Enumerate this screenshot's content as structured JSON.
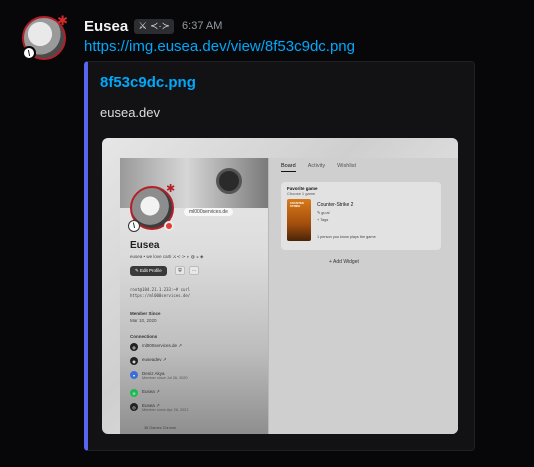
{
  "message": {
    "username": "Eusea",
    "role_badge": "⚔ ≺·≻",
    "timestamp": "6:37 AM",
    "link": "https://img.eusea.dev/view/8f53c9dc.png"
  },
  "embed": {
    "title": "8f53c9dc.png",
    "description": "eusea.dev"
  },
  "profile": {
    "bio_bubble": "ml000services.de",
    "display_name": "Eusea",
    "subtitle": "eusea • we love carti  ⚔≺·≻  ◐ ◍ ◒ ◈",
    "edit_button": "✎ Edit Profile",
    "code_line1": "root@104.21.1.233:~# curl",
    "code_line2": "https://ml000services.de/",
    "member_since_label": "Member Since",
    "member_since_value": "Mar 10, 2020",
    "connections_label": "Connections",
    "connections": [
      {
        "name": "ml000services.de ↗",
        "sub": ""
      },
      {
        "name": "euseadev ↗",
        "sub": ""
      },
      {
        "name": "Deniz Akya",
        "sub": "Member since Jul 26, 2020"
      },
      {
        "name": "Eusea ↗",
        "sub": ""
      },
      {
        "name": "Eusea ↗",
        "sub": "Member since Apr 26, 2021"
      }
    ],
    "footer": "38 Games   Chrome"
  },
  "panel": {
    "tabs": [
      "Board",
      "Activity",
      "Wishlist"
    ],
    "widget_title": "Favorite game",
    "widget_sub": "Choose 1 game",
    "cover_text": "COUNTER STRIKE",
    "game_name": "Counter-Strike 2",
    "game_meta1": "✎ gu:al",
    "game_meta2": "+ Tags",
    "game_meta3": "1 person you know plays the game",
    "add_widget": "+ Add Widget"
  }
}
